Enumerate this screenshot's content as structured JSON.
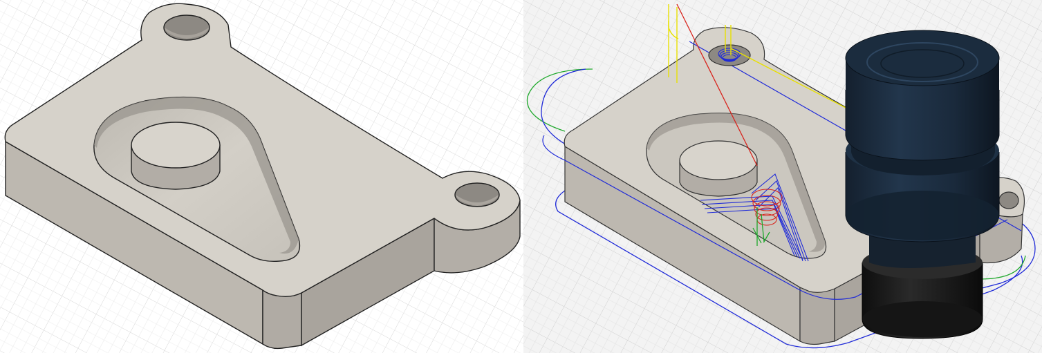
{
  "views": [
    {
      "id": "design-view",
      "content": "model-viewport",
      "background": "#ffffff",
      "grid_visible": true
    },
    {
      "id": "manufacture-view",
      "content": "toolpath-simulation-viewport",
      "background": "#f3f3f3",
      "grid_visible": true
    }
  ],
  "colors": {
    "part_top": "#d6d2ca",
    "part_side": "#bbb6ae",
    "part_side_dark": "#a9a49d",
    "pocket_floor": "#ccc8c0",
    "edge": "#222222",
    "grid": "#d8d8d8",
    "toolpath_blue": "#1f2ad8",
    "toolpath_red": "#d8241d",
    "toolpath_green": "#1ea82b",
    "toolpath_yellow": "#e8e000",
    "tool_holder": "#1c2c3e",
    "tool_holder_shade": "#0f1a27",
    "tool_collet": "#1a1a1a"
  },
  "icons": {
    "tool": "cnc-tool-holder-icon"
  }
}
